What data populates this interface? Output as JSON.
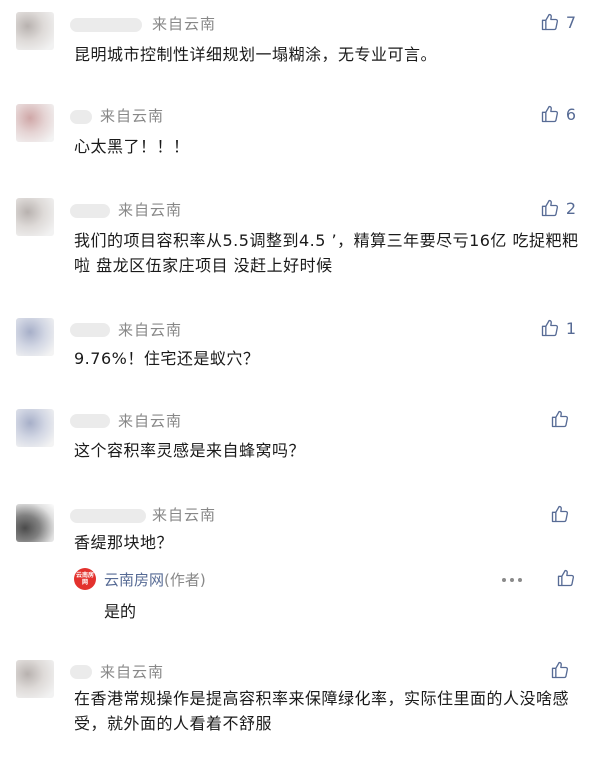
{
  "comments": [
    {
      "source": "来自云南",
      "text": "昆明城市控制性详细规划一塌糊涂，无专业可言。",
      "likes": "7"
    },
    {
      "source": "来自云南",
      "text": "心太黑了！！！",
      "likes": "6"
    },
    {
      "source": "来自云南",
      "text": "我们的项目容积率从5.5调整到4.5 ’，精算三年要尽亏16亿  吃捉粑粑啦  盘龙区伍家庄项目  没赶上好时候",
      "likes": "2"
    },
    {
      "source": "来自云南",
      "text": "9.76%！住宅还是蚁穴？",
      "likes": "1"
    },
    {
      "source": "来自云南",
      "text": "这个容积率灵感是来自蜂窝吗？",
      "likes": ""
    },
    {
      "source": "来自云南",
      "text": "香缇那块地？",
      "likes": "",
      "reply": {
        "name": "云南房网",
        "author_tag": "(作者)",
        "text": "是的",
        "avatar_text": "云南房网"
      }
    },
    {
      "source": "来自云南",
      "text": "在香港常规操作是提高容积率来保障绿化率，实际住里面的人没啥感受，就外面的人看着不舒服",
      "likes": ""
    }
  ],
  "colors": {
    "link": "#576b95",
    "meta": "#888888",
    "text": "#1a1a1a",
    "brand": "#e3312d"
  },
  "icons": {
    "like": "thumbs-up-icon",
    "more": "more-dots-icon"
  }
}
